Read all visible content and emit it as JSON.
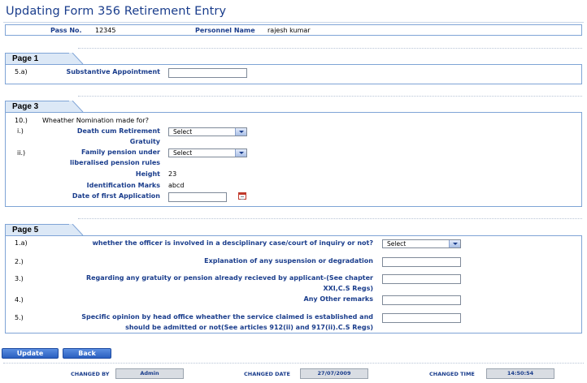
{
  "title": "Updating Form 356 Retirement Entry",
  "header": {
    "pass_no_label": "Pass No.",
    "pass_no_value": "12345",
    "personnel_name_label": "Personnel Name",
    "personnel_name_value": "rajesh kumar"
  },
  "page1": {
    "tab": "Page 1",
    "q5a_num": "5.a)",
    "q5a_label": "Substantive Appointment",
    "q5a_value": ""
  },
  "page3": {
    "tab": "Page 3",
    "q10_num": "10.)",
    "q10_text": "Wheather Nomination made for?",
    "qi_num": "i.)",
    "qi_label_line1": "Death cum Retirement",
    "qi_label_line2": "Gratuity",
    "qi_select": "Select",
    "qii_num": "ii.)",
    "qii_label_line1": "Family pension under",
    "qii_label_line2": "liberalised pension rules",
    "qii_select": "Select",
    "height_label": "Height",
    "height_value": "23",
    "ident_label": "Identification Marks",
    "ident_value": "abcd",
    "date_label": "Date of first Application",
    "date_value": ""
  },
  "page5": {
    "tab": "Page 5",
    "q1a_num": "1.a)",
    "q1a_label": "whether the officer is involved in a desciplinary case/court of inquiry or not?",
    "q1a_select": "Select",
    "q2_num": "2.)",
    "q2_label": "Explanation of any suspension or degradation",
    "q3_num": "3.)",
    "q3_label_line1": "Regarding any gratuity or pension already recieved by applicant-(See chapter",
    "q3_label_line2": "XXI,C.S Regs)",
    "q4_num": "4.)",
    "q4_label": "Any Other remarks",
    "q5_num": "5.)",
    "q5_label_line1": "Specific opinion by head office wheather the service claimed is established and",
    "q5_label_line2": "should be admitted or not(See articles 912(ii) and 917(ii).C.S Regs)"
  },
  "buttons": {
    "update": "Update",
    "back": "Back"
  },
  "footer": {
    "changed_by_label": "CHANGED BY",
    "changed_by_value": "Admin",
    "changed_date_label": "CHANGED DATE",
    "changed_date_value": "27/07/2009",
    "changed_time_label": "CHANGED TIME",
    "changed_time_value": "14:50:54"
  },
  "colors": {
    "accent": "#1a3d8c",
    "border": "#7fa4d6",
    "tab_bg": "#dce8f6",
    "button": "#2a5fc0"
  }
}
